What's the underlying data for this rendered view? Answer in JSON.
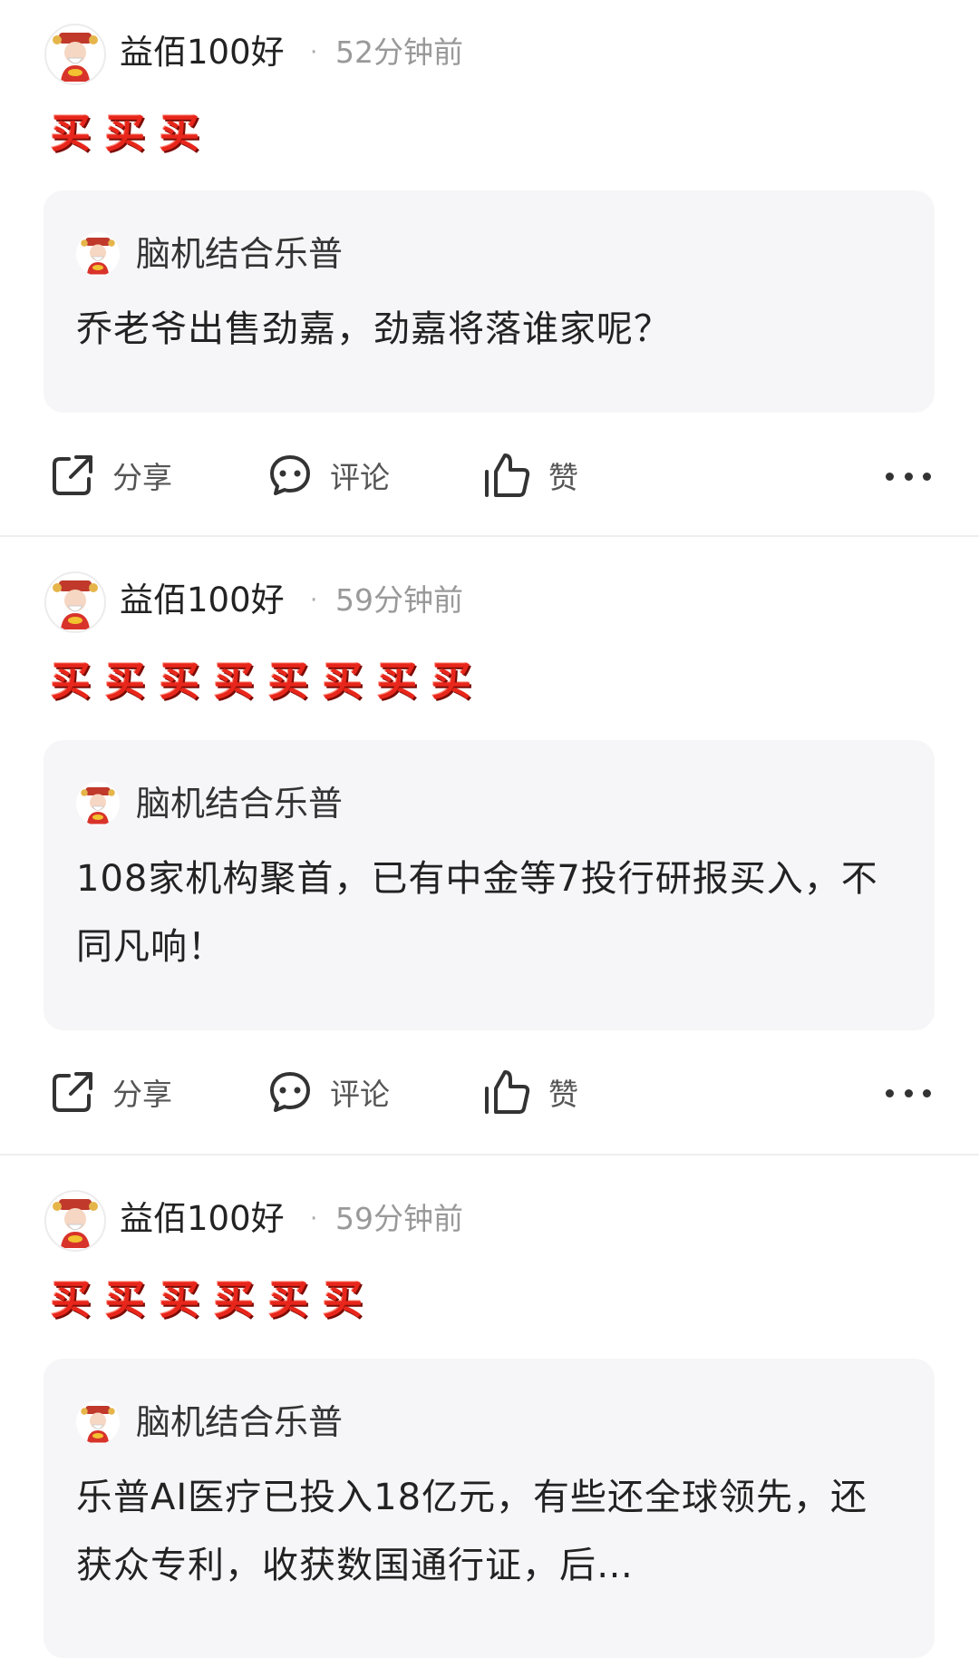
{
  "emoji_glyph": "买",
  "actions": {
    "share": "分享",
    "comment": "评论",
    "like": "赞"
  },
  "posts": [
    {
      "author": "益佰100好",
      "separator": "·",
      "time": "52分钟前",
      "emoji_count": 3,
      "quote": {
        "author": "脑机结合乐普",
        "text": "乔老爷出售劲嘉，劲嘉将落谁家呢？"
      }
    },
    {
      "author": "益佰100好",
      "separator": "·",
      "time": "59分钟前",
      "emoji_count": 8,
      "quote": {
        "author": "脑机结合乐普",
        "text": "108家机构聚首，已有中金等7投行研报买入，不同凡响！"
      }
    },
    {
      "author": "益佰100好",
      "separator": "·",
      "time": "59分钟前",
      "emoji_count": 6,
      "quote": {
        "author": "脑机结合乐普",
        "text": "乐普AI医疗已投入18亿元，有些还全球领先，还获众专利，收获数国通行证，后…"
      }
    }
  ]
}
